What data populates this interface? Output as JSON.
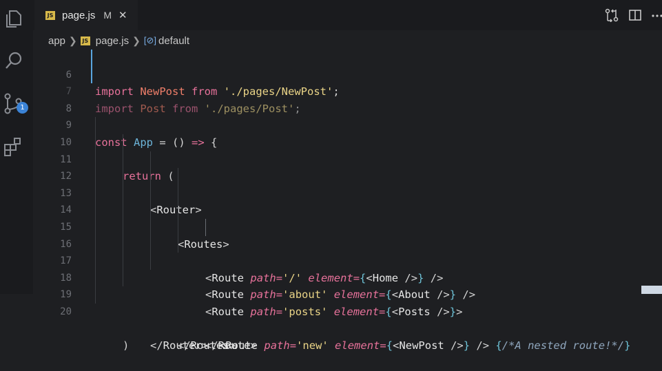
{
  "activity_bar": {
    "badge": "1"
  },
  "tab": {
    "label": "page.js",
    "modified": "M",
    "close": "✕",
    "file_badge": "JS"
  },
  "breadcrumb": {
    "folder": "app",
    "file": "page.js",
    "symbol": "default",
    "file_badge": "JS"
  },
  "code": {
    "line_numbers": [
      "6",
      "7",
      "8",
      "9",
      "10",
      "11",
      "12",
      "13",
      "14",
      "15",
      "16",
      "17",
      "18",
      "19",
      "20"
    ],
    "line6": [
      "import",
      " ",
      "NewPost",
      " ",
      "from",
      " ",
      "'./pages/NewPost'",
      ";"
    ],
    "line7": [
      "import",
      " ",
      "Post",
      " ",
      "from",
      " ",
      "'./pages/Post'",
      ";"
    ],
    "line9": [
      "const",
      " ",
      "App",
      " = () ",
      "=>",
      " {"
    ],
    "line10": [
      "return",
      " ("
    ],
    "line11": [
      "<",
      "Router",
      ">"
    ],
    "line12": [
      "<",
      "Routes",
      ">"
    ],
    "line13": [
      "<",
      "Route",
      " ",
      "path",
      "=",
      "'/'",
      " ",
      "element",
      "=",
      "{",
      "<",
      "Home",
      " />",
      "}",
      " />"
    ],
    "line14": [
      "<",
      "Route",
      " ",
      "path",
      "=",
      "'about'",
      " ",
      "element",
      "=",
      "{",
      "<",
      "About",
      " />",
      "}",
      " />"
    ],
    "line15": [
      "<",
      "Route",
      " ",
      "path",
      "=",
      "'posts'",
      " ",
      "element",
      "=",
      "{",
      "<",
      "Posts",
      " />",
      "}",
      ">"
    ],
    "line16": [
      "<",
      "Route",
      " ",
      "path",
      "=",
      "'new'",
      " ",
      "element",
      "=",
      "{",
      "<",
      "NewPost",
      " />",
      "}",
      " />",
      " ",
      "{",
      "/*A nested route!*/",
      "}"
    ],
    "line17": [
      "</",
      "Route",
      ">"
    ],
    "line18": [
      "</",
      "Routes",
      ">"
    ],
    "line19": [
      "</",
      "Router",
      ">"
    ],
    "line20": [
      ")"
    ]
  }
}
